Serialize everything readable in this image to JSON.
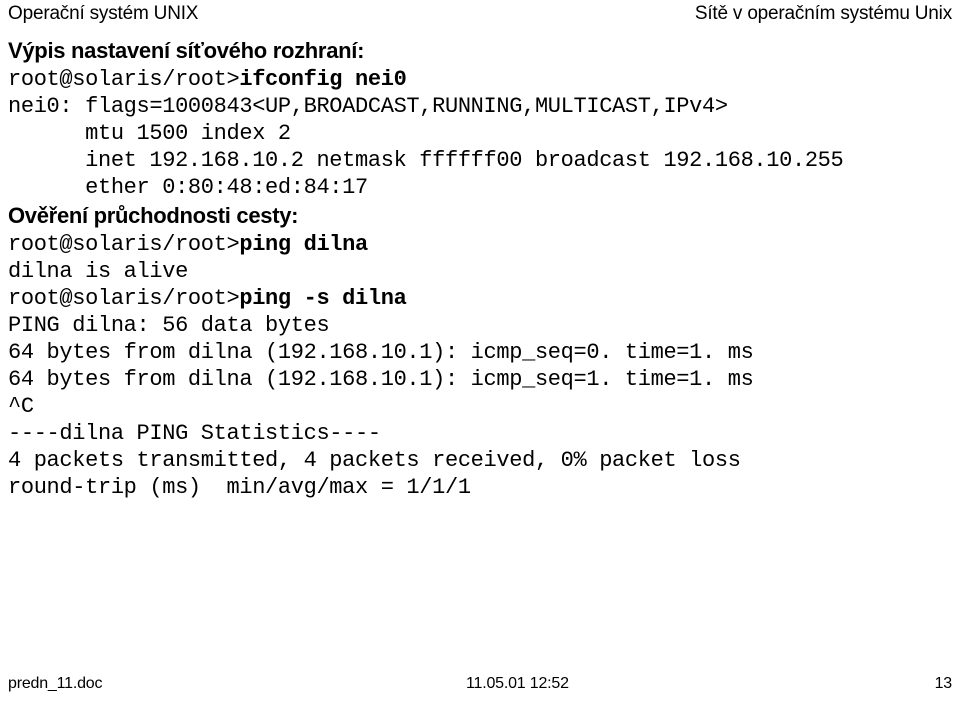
{
  "header": {
    "left": "Operační systém UNIX",
    "right": "Sítě v operačním systému Unix"
  },
  "sections": {
    "heading_ifconfig": "Výpis nastavení síťového rozhraní:",
    "heading_ping": "Ověření průchodnosti cesty:"
  },
  "terminal_ifconfig": {
    "prompt": "root@solaris/root>",
    "command": "ifconfig nei0",
    "output": "nei0: flags=1000843<UP,BROADCAST,RUNNING,MULTICAST,IPv4>\n      mtu 1500 index 2\n      inet 192.168.10.2 netmask ffffff00 broadcast 192.168.10.255\n      ether 0:80:48:ed:84:17"
  },
  "terminal_ping": {
    "prompt_1": "root@solaris/root>",
    "command_1": "ping dilna",
    "output_1": "dilna is alive",
    "prompt_2": "root@solaris/root>",
    "command_2": "ping -s dilna",
    "output_2": "PING dilna: 56 data bytes\n64 bytes from dilna (192.168.10.1): icmp_seq=0. time=1. ms\n64 bytes from dilna (192.168.10.1): icmp_seq=1. time=1. ms\n^C\n----dilna PING Statistics----\n4 packets transmitted, 4 packets received, 0% packet loss\nround-trip (ms)  min/avg/max = 1/1/1"
  },
  "footer": {
    "file_name": "predn_11.doc",
    "timestamp": "11.05.01 12:52",
    "page_number": "13"
  },
  "colors": {
    "text": "#000000",
    "background": "#ffffff"
  }
}
